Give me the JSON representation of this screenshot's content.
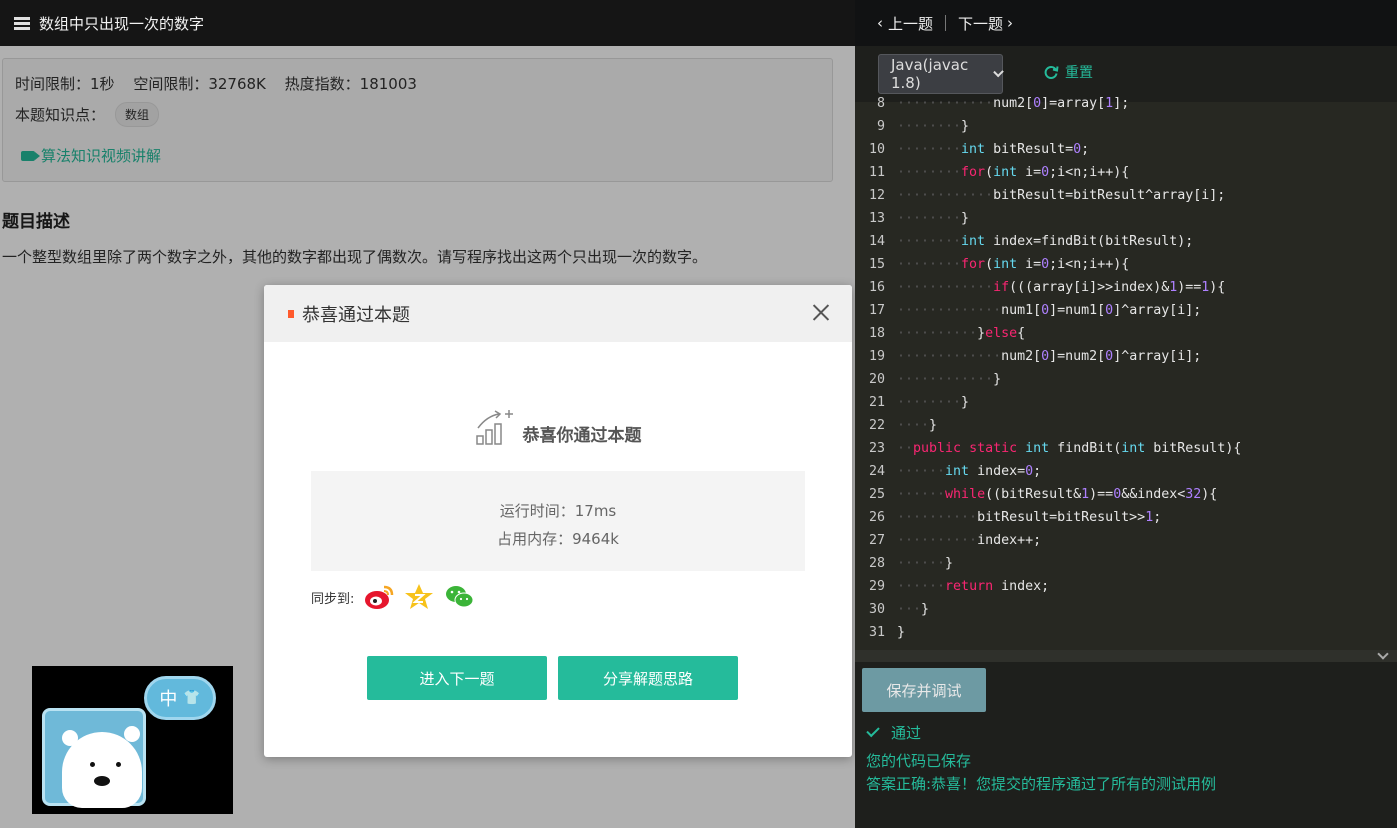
{
  "problem": {
    "title": "数组中只出现一次的数字",
    "limits": [
      "时间限制：1秒",
      "空间限制：32768K",
      "热度指数：181003"
    ],
    "knowledge_label": "本题知识点：",
    "knowledge_tag": "数组",
    "video_link": "算法知识视频讲解",
    "desc_title": "题目描述",
    "desc_text": "一个整型数组里除了两个数字之外，其他的数字都出现了偶数次。请写程序找出这两个只出现一次的数字。"
  },
  "modal": {
    "title": "恭喜通过本题",
    "success_text": "恭喜你通过本题",
    "run_time": "运行时间：17ms",
    "memory": "占用内存：9464k",
    "sync_label": "同步到:",
    "next_button": "进入下一题",
    "share_button": "分享解题思路"
  },
  "mascot": {
    "label": "中"
  },
  "editor": {
    "prev": "上一题",
    "next": "下一题",
    "language": "Java(javac 1.8)",
    "reset": "重置",
    "lines": [
      {
        "n": "8",
        "code": "            num2[0]=array[1];"
      },
      {
        "n": "9",
        "code": "        }"
      },
      {
        "n": "10",
        "code": "        int bitResult=0;"
      },
      {
        "n": "11",
        "code": "        for(int i=0;i<n;i++){"
      },
      {
        "n": "12",
        "code": "            bitResult=bitResult^array[i];"
      },
      {
        "n": "13",
        "code": "        }"
      },
      {
        "n": "14",
        "code": "        int index=findBit(bitResult);"
      },
      {
        "n": "15",
        "code": "        for(int i=0;i<n;i++){"
      },
      {
        "n": "16",
        "code": "            if(((array[i]>>index)&1)==1){"
      },
      {
        "n": "17",
        "code": "             num1[0]=num1[0]^array[i];"
      },
      {
        "n": "18",
        "code": "          }else{"
      },
      {
        "n": "19",
        "code": "             num2[0]=num2[0]^array[i];"
      },
      {
        "n": "20",
        "code": "            }"
      },
      {
        "n": "21",
        "code": "        }"
      },
      {
        "n": "22",
        "code": "    }"
      },
      {
        "n": "23",
        "code": "  public static int findBit(int bitResult){"
      },
      {
        "n": "24",
        "code": "      int index=0;"
      },
      {
        "n": "25",
        "code": "      while((bitResult&1)==0&&index<32){"
      },
      {
        "n": "26",
        "code": "          bitResult=bitResult>>1;"
      },
      {
        "n": "27",
        "code": "          index++;"
      },
      {
        "n": "28",
        "code": "      }"
      },
      {
        "n": "29",
        "code": "      return index;"
      },
      {
        "n": "30",
        "code": "   }"
      },
      {
        "n": "31",
        "code": "}"
      }
    ],
    "save_button": "保存并调试",
    "status": "通过",
    "saved_msg": "您的代码已保存",
    "result_msg": "答案正确:恭喜！您提交的程序通过了所有的测试用例"
  },
  "colors": {
    "accent": "#25bb9b",
    "editor_bg": "#272822",
    "keyword": "#f92672",
    "type": "#66d9ef",
    "number": "#ae81ff"
  }
}
